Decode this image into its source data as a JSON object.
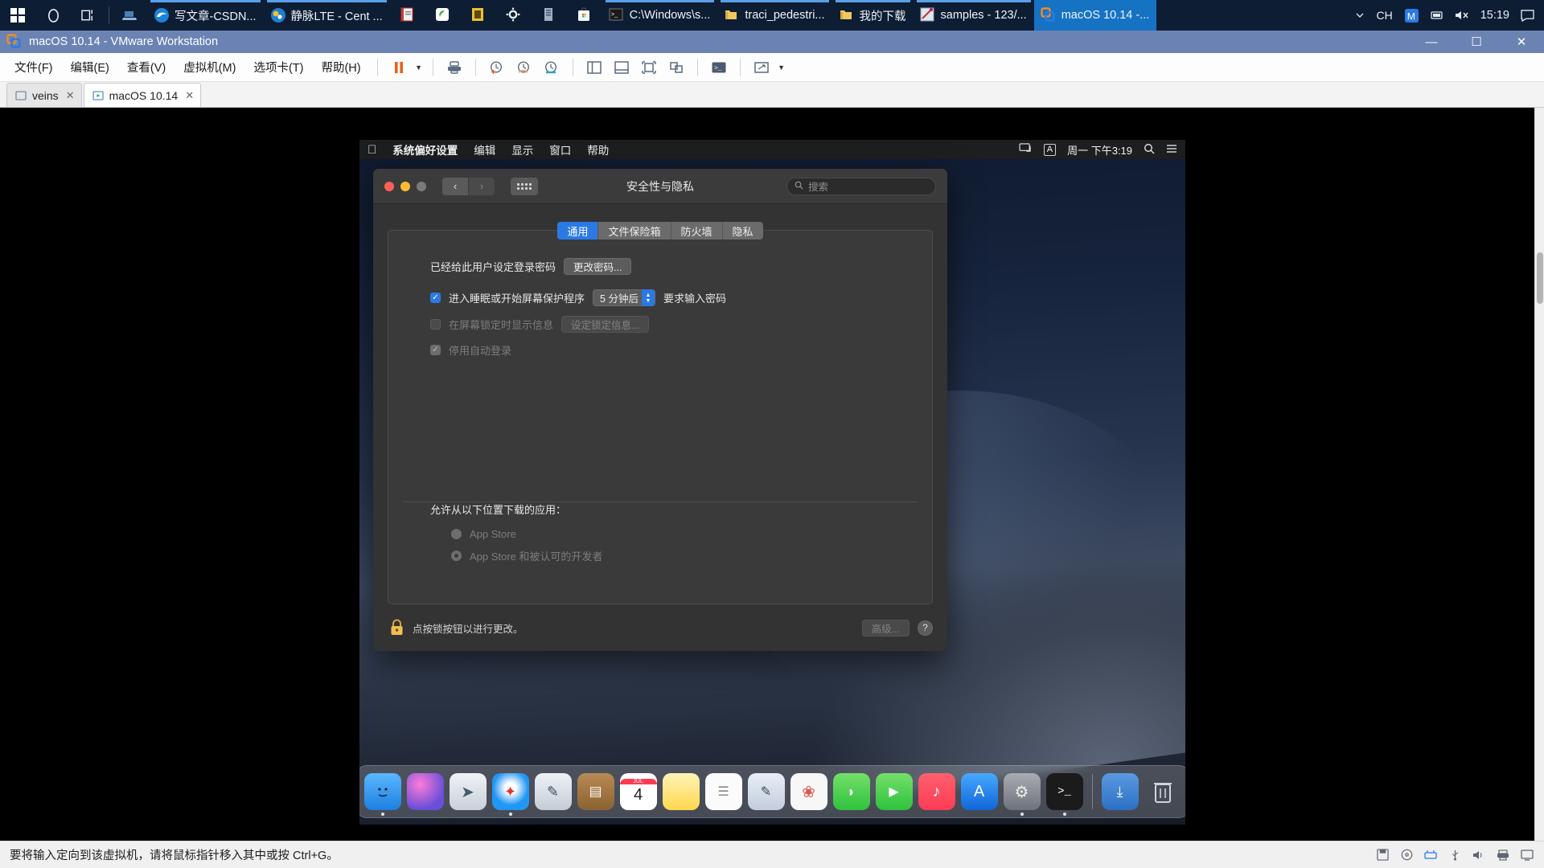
{
  "taskbar": {
    "system_buttons": [
      {
        "name": "start-button",
        "icon": "windows-logo-icon"
      },
      {
        "name": "cortana-button",
        "icon": "circle-search-icon"
      },
      {
        "name": "task-view-button",
        "icon": "task-view-icon"
      }
    ],
    "pinned": [
      {
        "name": "remote-desktop",
        "icon": "laptop-icon"
      }
    ],
    "tasks": [
      {
        "label": "写文章-CSDN...",
        "icon": "edge-icon",
        "state": "open"
      },
      {
        "label": "静脉LTE - Cent ...",
        "icon": "globe-icon",
        "state": "open"
      },
      {
        "label": "",
        "icon": "notepad-app-icon",
        "state": "pinned"
      },
      {
        "label": "",
        "icon": "green-leaf-icon",
        "state": "pinned"
      },
      {
        "label": "",
        "icon": "yellow-frame-icon",
        "state": "pinned"
      },
      {
        "label": "",
        "icon": "gear-icon",
        "state": "pinned"
      },
      {
        "label": "",
        "icon": "server-icon",
        "state": "pinned"
      },
      {
        "label": "",
        "icon": "store-icon",
        "state": "pinned"
      },
      {
        "label": "C:\\Windows\\s...",
        "icon": "console-icon",
        "state": "open"
      },
      {
        "label": "traci_pedestri...",
        "icon": "folder-icon",
        "state": "open"
      },
      {
        "label": "我的下载",
        "icon": "folder-icon",
        "state": "open"
      },
      {
        "label": "samples - 123/...",
        "icon": "editor-icon",
        "state": "open"
      },
      {
        "label": "macOS 10.14 -...",
        "icon": "vmware-icon",
        "state": "active"
      }
    ],
    "tray": {
      "ime": "CH",
      "ime_mode": "M",
      "chevron": "show-hidden-icons",
      "network": "network-icon",
      "volume": "volume-muted-icon",
      "clock": "15:19",
      "notifications": "action-center-icon"
    }
  },
  "vmware": {
    "title": "macOS 10.14 - VMware Workstation",
    "window_buttons": {
      "minimize": "—",
      "maximize": "☐",
      "close": "✕"
    },
    "menus": [
      "文件(F)",
      "编辑(E)",
      "查看(V)",
      "虚拟机(M)",
      "选项卡(T)",
      "帮助(H)"
    ],
    "toolbar_icons": [
      "suspend-icon",
      "power-dropdown-icon",
      "send-ctrl-alt-del-icon",
      "snapshot-take-icon",
      "snapshot-revert-icon",
      "snapshot-manager-icon",
      "show-library-icon",
      "show-thumbnail-bar-icon",
      "full-screen-icon",
      "unity-mode-icon",
      "console-view-icon",
      "stretch-icon",
      "stretch-dropdown-icon"
    ],
    "tabs": [
      {
        "label": "veins",
        "icon": "vm-tab-icon",
        "selected": false
      },
      {
        "label": "macOS 10.14",
        "icon": "vm-tab-running-icon",
        "selected": true
      }
    ]
  },
  "macos": {
    "menubar": {
      "apple": "apple-logo-icon",
      "items": [
        "系统偏好设置",
        "编辑",
        "显示",
        "窗口",
        "帮助"
      ],
      "status_icons": [
        "screen-mirroring-icon",
        "input-source-a-icon"
      ],
      "datetime": "周一 下午3:19",
      "search": "spotlight-icon",
      "control_center": "siri-list-icon"
    },
    "prefs": {
      "title": "安全性与隐私",
      "traffic_lights": [
        "close",
        "minimize",
        "zoom"
      ],
      "nav_back": "‹",
      "nav_forward": "›",
      "grid_button": "show-all-icon",
      "search_placeholder": "搜索",
      "tabs": [
        {
          "label": "通用",
          "selected": true
        },
        {
          "label": "文件保险箱",
          "selected": false
        },
        {
          "label": "防火墙",
          "selected": false
        },
        {
          "label": "隐私",
          "selected": false
        }
      ],
      "general": {
        "password_set_label": "已经给此用户设定登录密码",
        "change_password_button": "更改密码...",
        "require_password_checkbox": {
          "label": "进入睡眠或开始屏幕保护程序",
          "checked": true
        },
        "require_password_delay": "5 分钟后",
        "require_password_suffix": "要求输入密码",
        "show_message_checkbox": {
          "label": "在屏幕锁定时显示信息",
          "checked": false,
          "disabled": true
        },
        "set_lock_message_button": "设定锁定信息...",
        "disable_auto_login_checkbox": {
          "label": "停用自动登录",
          "checked": true,
          "disabled": true
        }
      },
      "downloads": {
        "heading": "允许从以下位置下载的应用：",
        "options": [
          {
            "label": "App Store",
            "selected": false
          },
          {
            "label": "App Store 和被认可的开发者",
            "selected": true
          }
        ]
      },
      "footer": {
        "lock_icon": "lock-closed-icon",
        "note": "点按锁按钮以进行更改。",
        "advanced_button": "高级...",
        "help_button": "?"
      }
    },
    "dock": {
      "apps": [
        {
          "name": "finder",
          "glyph": "🙂",
          "color": "#2d9cf5",
          "running": true
        },
        {
          "name": "siri",
          "glyph": "◉",
          "color": "#6a4fd8",
          "running": false
        },
        {
          "name": "launchpad",
          "glyph": "🚀",
          "color": "#cfd4da",
          "running": false
        },
        {
          "name": "safari",
          "glyph": "🧭",
          "color": "#2196f3",
          "running": true
        },
        {
          "name": "mail-xcode",
          "glyph": "✎",
          "color": "#e9edf2",
          "running": false
        },
        {
          "name": "contacts",
          "glyph": "📒",
          "color": "#a97a4a",
          "running": false
        },
        {
          "name": "calendar",
          "glyph": "4",
          "color": "#ffffff",
          "running": false
        },
        {
          "name": "notes",
          "glyph": "▤",
          "color": "#ffe27a",
          "running": false
        },
        {
          "name": "reminders",
          "glyph": "☰",
          "color": "#f4f4f4",
          "running": false
        },
        {
          "name": "preview",
          "glyph": "🔧",
          "color": "#dfe5ec",
          "running": false
        },
        {
          "name": "photos",
          "glyph": "❀",
          "color": "#f3f3f3",
          "running": false
        },
        {
          "name": "messages",
          "glyph": "💬",
          "color": "#4cd964",
          "running": false
        },
        {
          "name": "facetime",
          "glyph": "📹",
          "color": "#4cd964",
          "running": false
        },
        {
          "name": "music",
          "glyph": "♪",
          "color": "#fc3c55",
          "running": false
        },
        {
          "name": "app-store",
          "glyph": "A",
          "color": "#1e90ff",
          "running": false
        },
        {
          "name": "system-preferences",
          "glyph": "⚙",
          "color": "#8e8e93",
          "running": true
        },
        {
          "name": "terminal",
          "glyph": ">_",
          "color": "#1c1c1c",
          "running": true
        },
        {
          "name": "downloads-stack",
          "glyph": "⤓",
          "color": "#3f7fd0",
          "running": false
        },
        {
          "name": "trash",
          "glyph": "🗑",
          "color": "#c8ccd2",
          "running": false
        }
      ]
    },
    "calendar_day": "4"
  },
  "statusbar": {
    "message": "要将输入定向到该虚拟机，请将鼠标指针移入其中或按 Ctrl+G。",
    "icons": [
      "floppy-icon",
      "cd-icon",
      "network-adapter-icon",
      "usb-icon",
      "sound-icon",
      "printer-icon",
      "display-icon"
    ]
  }
}
